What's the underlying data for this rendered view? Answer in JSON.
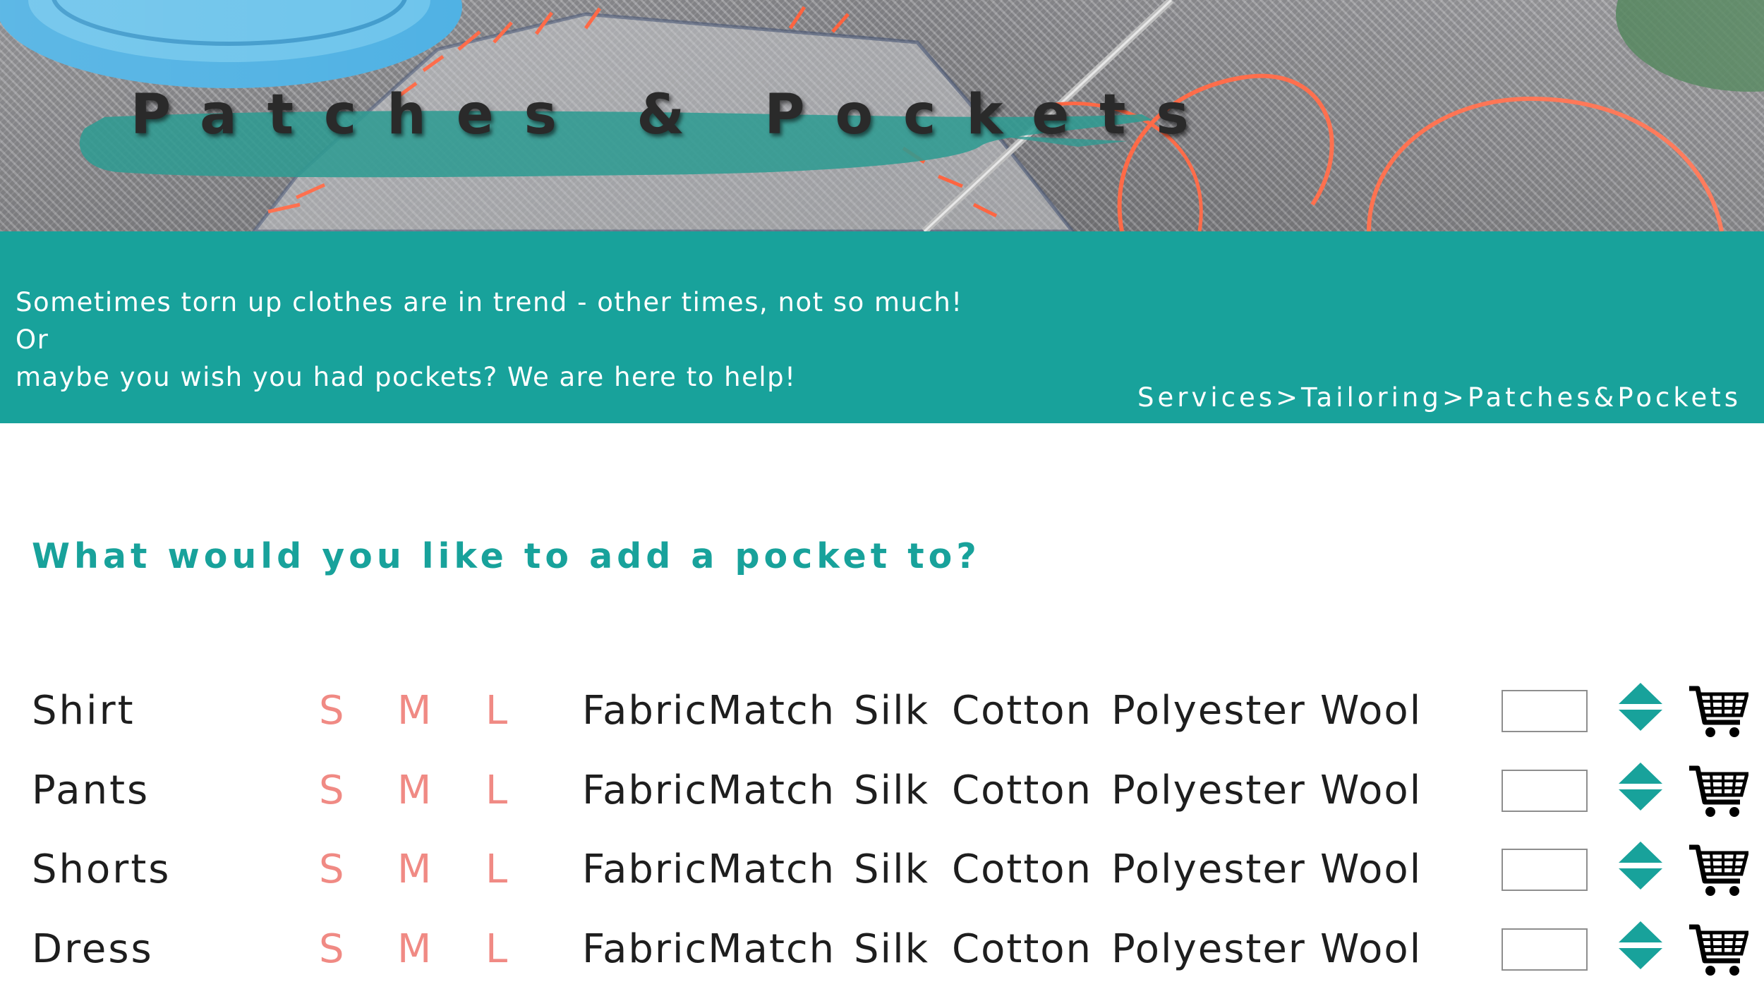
{
  "header": {
    "title": "Patches & Pockets"
  },
  "intro": {
    "line1": "Sometimes torn up clothes are in trend - other times, not so much! Or",
    "line2": "maybe you wish you had pockets? We are here to help!"
  },
  "breadcrumb": {
    "items": [
      "Services",
      "Tailoring",
      "Patches&Pockets"
    ],
    "separator": ">"
  },
  "question": "What would you like to add a pocket to?",
  "items": [
    {
      "name": "Shirt",
      "sizes": [
        "S",
        "M",
        "L"
      ],
      "fabrics": [
        "FabricMatch",
        "Silk",
        "Cotton",
        "Polyester",
        "Wool"
      ],
      "quantity": ""
    },
    {
      "name": "Pants",
      "sizes": [
        "S",
        "M",
        "L"
      ],
      "fabrics": [
        "FabricMatch",
        "Silk",
        "Cotton",
        "Polyester",
        "Wool"
      ],
      "quantity": ""
    },
    {
      "name": "Shorts",
      "sizes": [
        "S",
        "M",
        "L"
      ],
      "fabrics": [
        "FabricMatch",
        "Silk",
        "Cotton",
        "Polyester",
        "Wool"
      ],
      "quantity": ""
    },
    {
      "name": "Dress",
      "sizes": [
        "S",
        "M",
        "L"
      ],
      "fabrics": [
        "FabricMatch",
        "Silk",
        "Cotton",
        "Polyester",
        "Wool"
      ],
      "quantity": ""
    }
  ],
  "icons": {
    "stepper": "up-down-triangle-icon",
    "cart": "shopping-cart-icon"
  },
  "colors": {
    "teal": "#18a29b",
    "size_salmon": "#f08a84",
    "text_dark": "#1e1e1e"
  }
}
